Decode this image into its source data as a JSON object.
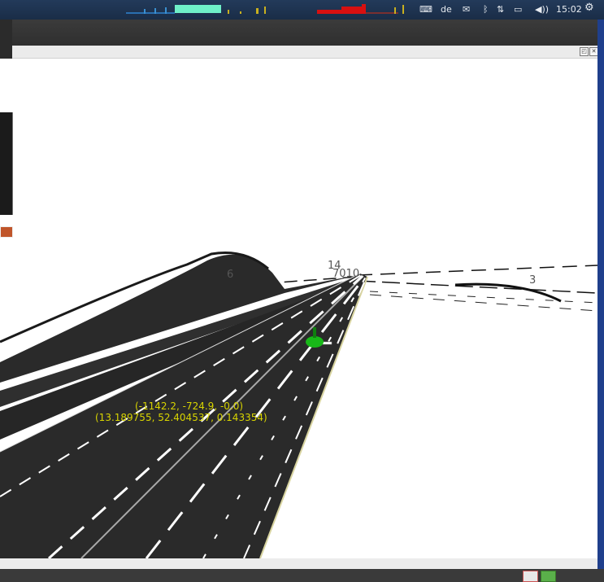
{
  "topbar": {
    "keyboard_layout": "de",
    "clock": "15:02",
    "icons": [
      "keyboard-icon",
      "mail-icon",
      "bluetooth-icon",
      "network-icon",
      "battery-icon",
      "volume-icon",
      "settings-gear-icon"
    ],
    "colors": {
      "bar": "#1f3452",
      "cpu_graph": "#5fe0c0",
      "net_graph": "#d81010"
    }
  },
  "viewport": {
    "road_labels": [
      "6",
      "14",
      "7010",
      "3"
    ],
    "coordinates_map": "(-1142.2, -724.9, -0.0)",
    "coordinates_geo": "(13.189755, 52.404537, 0.143354)",
    "colors": {
      "road": "#2a2a2a",
      "lane_marking": "#ffffff",
      "vehicle": "#18b818",
      "text": "#d8d400"
    }
  },
  "panel": {
    "float_button": "◰",
    "close_button": "✕"
  }
}
